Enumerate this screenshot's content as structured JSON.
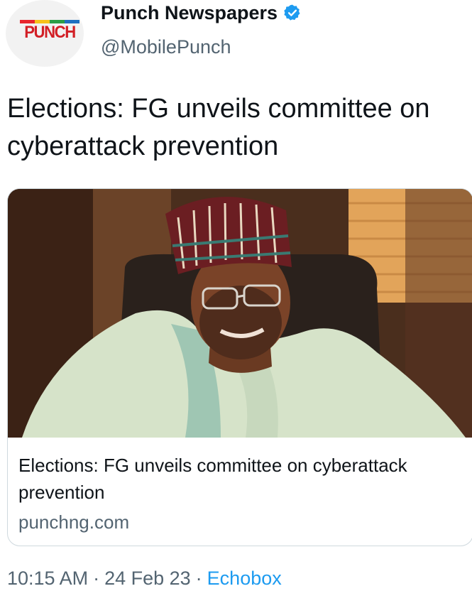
{
  "author": {
    "avatar_logo_text": "PUNCH",
    "display_name": "Punch Newspapers",
    "handle": "@MobilePunch",
    "verified": true
  },
  "tweet": {
    "text": "Elections: FG unveils committee on cyberattack prevention"
  },
  "link_card": {
    "image_alt": "Photo of a smiling man in glasses wearing a patterned cap and light green robe",
    "title": "Elections: FG unveils committee on cyberattack prevention",
    "domain": "punchng.com"
  },
  "meta": {
    "time": "10:15 AM",
    "separator": "·",
    "date": "24 Feb 23",
    "source": "Echobox"
  },
  "colors": {
    "text": "#0f1419",
    "secondary": "#536471",
    "accent": "#1d9bf0",
    "brand_red": "#d21f26"
  }
}
